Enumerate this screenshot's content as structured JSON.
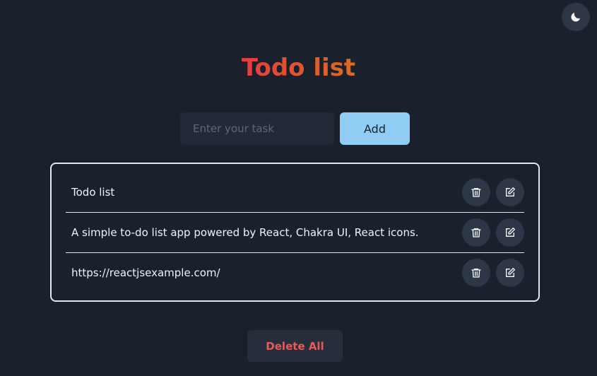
{
  "header": {
    "theme_toggle_icon": "moon-icon",
    "title": "Todo list",
    "title_gradient": [
      "#e53e3e",
      "#dd6b20"
    ]
  },
  "add_form": {
    "input_placeholder": "Enter your task",
    "input_value": "",
    "add_label": "Add"
  },
  "todos": [
    {
      "text": "Todo list",
      "delete_icon": "trash-icon",
      "edit_icon": "edit-icon"
    },
    {
      "text": "A simple to-do list app powered by React, Chakra UI, React icons.",
      "delete_icon": "trash-icon",
      "edit_icon": "edit-icon"
    },
    {
      "text": "https://reactjsexample.com/",
      "delete_icon": "trash-icon",
      "edit_icon": "edit-icon"
    }
  ],
  "footer": {
    "delete_all_label": "Delete All"
  },
  "colors": {
    "background": "#1a202c",
    "accent": "#90cdf4",
    "danger": "#e85a5a"
  }
}
